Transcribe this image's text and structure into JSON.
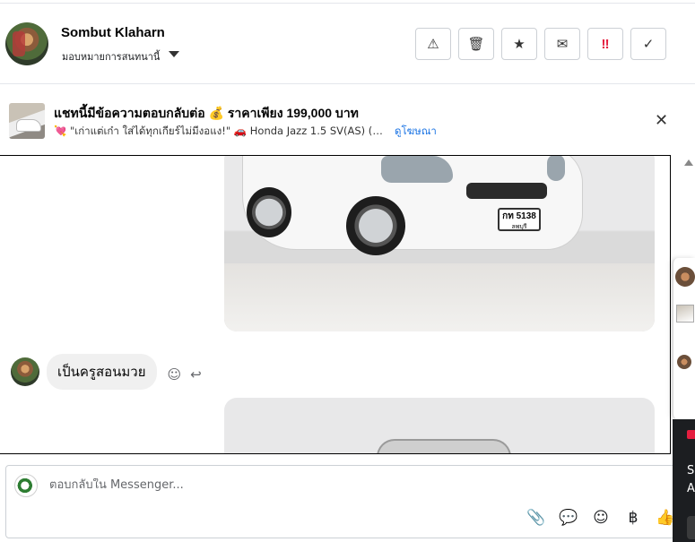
{
  "header": {
    "name": "Sombut Klaharn",
    "assign_label": "มอบหมายการสนทนานี้",
    "actions": [
      {
        "name": "report-icon",
        "glyph": "⚠"
      },
      {
        "name": "trash-icon",
        "glyph": "🗑"
      },
      {
        "name": "star-icon",
        "glyph": "★"
      },
      {
        "name": "envelope-icon",
        "glyph": "✉"
      },
      {
        "name": "spam-icon",
        "glyph": "‼"
      },
      {
        "name": "check-icon",
        "glyph": "✓"
      }
    ]
  },
  "banner": {
    "title": "แชทนี้มีข้อความตอบกลับต่อ 💰 ราคาเพียง 199,000 บาท",
    "description": "💘 \"เก่าแต่เก๋า ใส่ได้ทุกเกียร์ไม่มีงอแง!\" 🚗 Honda Jazz 1.5 SV(AS) (M...",
    "link": "ดูโฆษณา",
    "close_glyph": "✕"
  },
  "car_plate": {
    "line1": "กท 5138",
    "line2": "ลพบุรี"
  },
  "message": {
    "text": "เป็นครูสอนมวย",
    "react_glyph": "☺",
    "reply_glyph": "↩"
  },
  "composer": {
    "placeholder": "ตอบกลับใน Messenger...",
    "tools": [
      {
        "name": "attach-icon",
        "glyph": "📎"
      },
      {
        "name": "saved-reply-icon",
        "glyph": "💬"
      },
      {
        "name": "emoji-icon",
        "glyph": "☺"
      },
      {
        "name": "baht-icon",
        "glyph": "฿"
      },
      {
        "name": "thumbs-up-icon",
        "glyph": "👍"
      }
    ]
  },
  "side_panel": {
    "text1": "S",
    "text2": "A"
  }
}
